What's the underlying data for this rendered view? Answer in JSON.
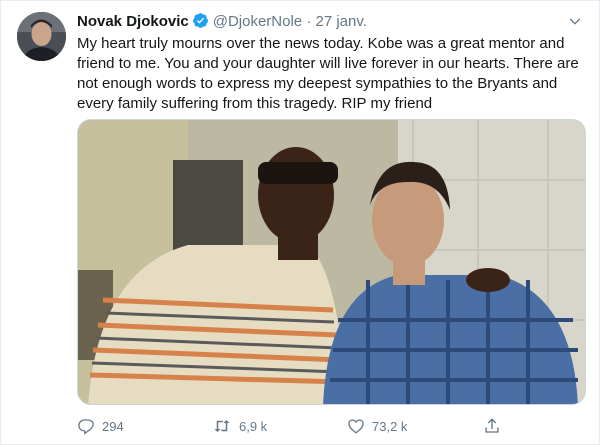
{
  "tweet": {
    "author_name": "Novak Djokovic",
    "handle": "@DjokerNole",
    "separator": "·",
    "date": "27 janv.",
    "lines": [
      "My heart truly mourns over the news today. Kobe was a great mentor and",
      "friend to me. You and your daughter will live forever in our hearts. There are",
      "not enough words to express my deepest sympathies to the Bryants and",
      "every family suffering from this tragedy. RIP my friend"
    ]
  },
  "actions": {
    "replies": "294",
    "retweets": "6,9 k",
    "likes": "73,2 k"
  },
  "colors": {
    "accent": "#1da1f2",
    "secondary_text": "#657786"
  },
  "icons": [
    "verified-badge-icon",
    "chevron-down-icon",
    "reply-icon",
    "retweet-icon",
    "like-icon",
    "share-icon"
  ]
}
